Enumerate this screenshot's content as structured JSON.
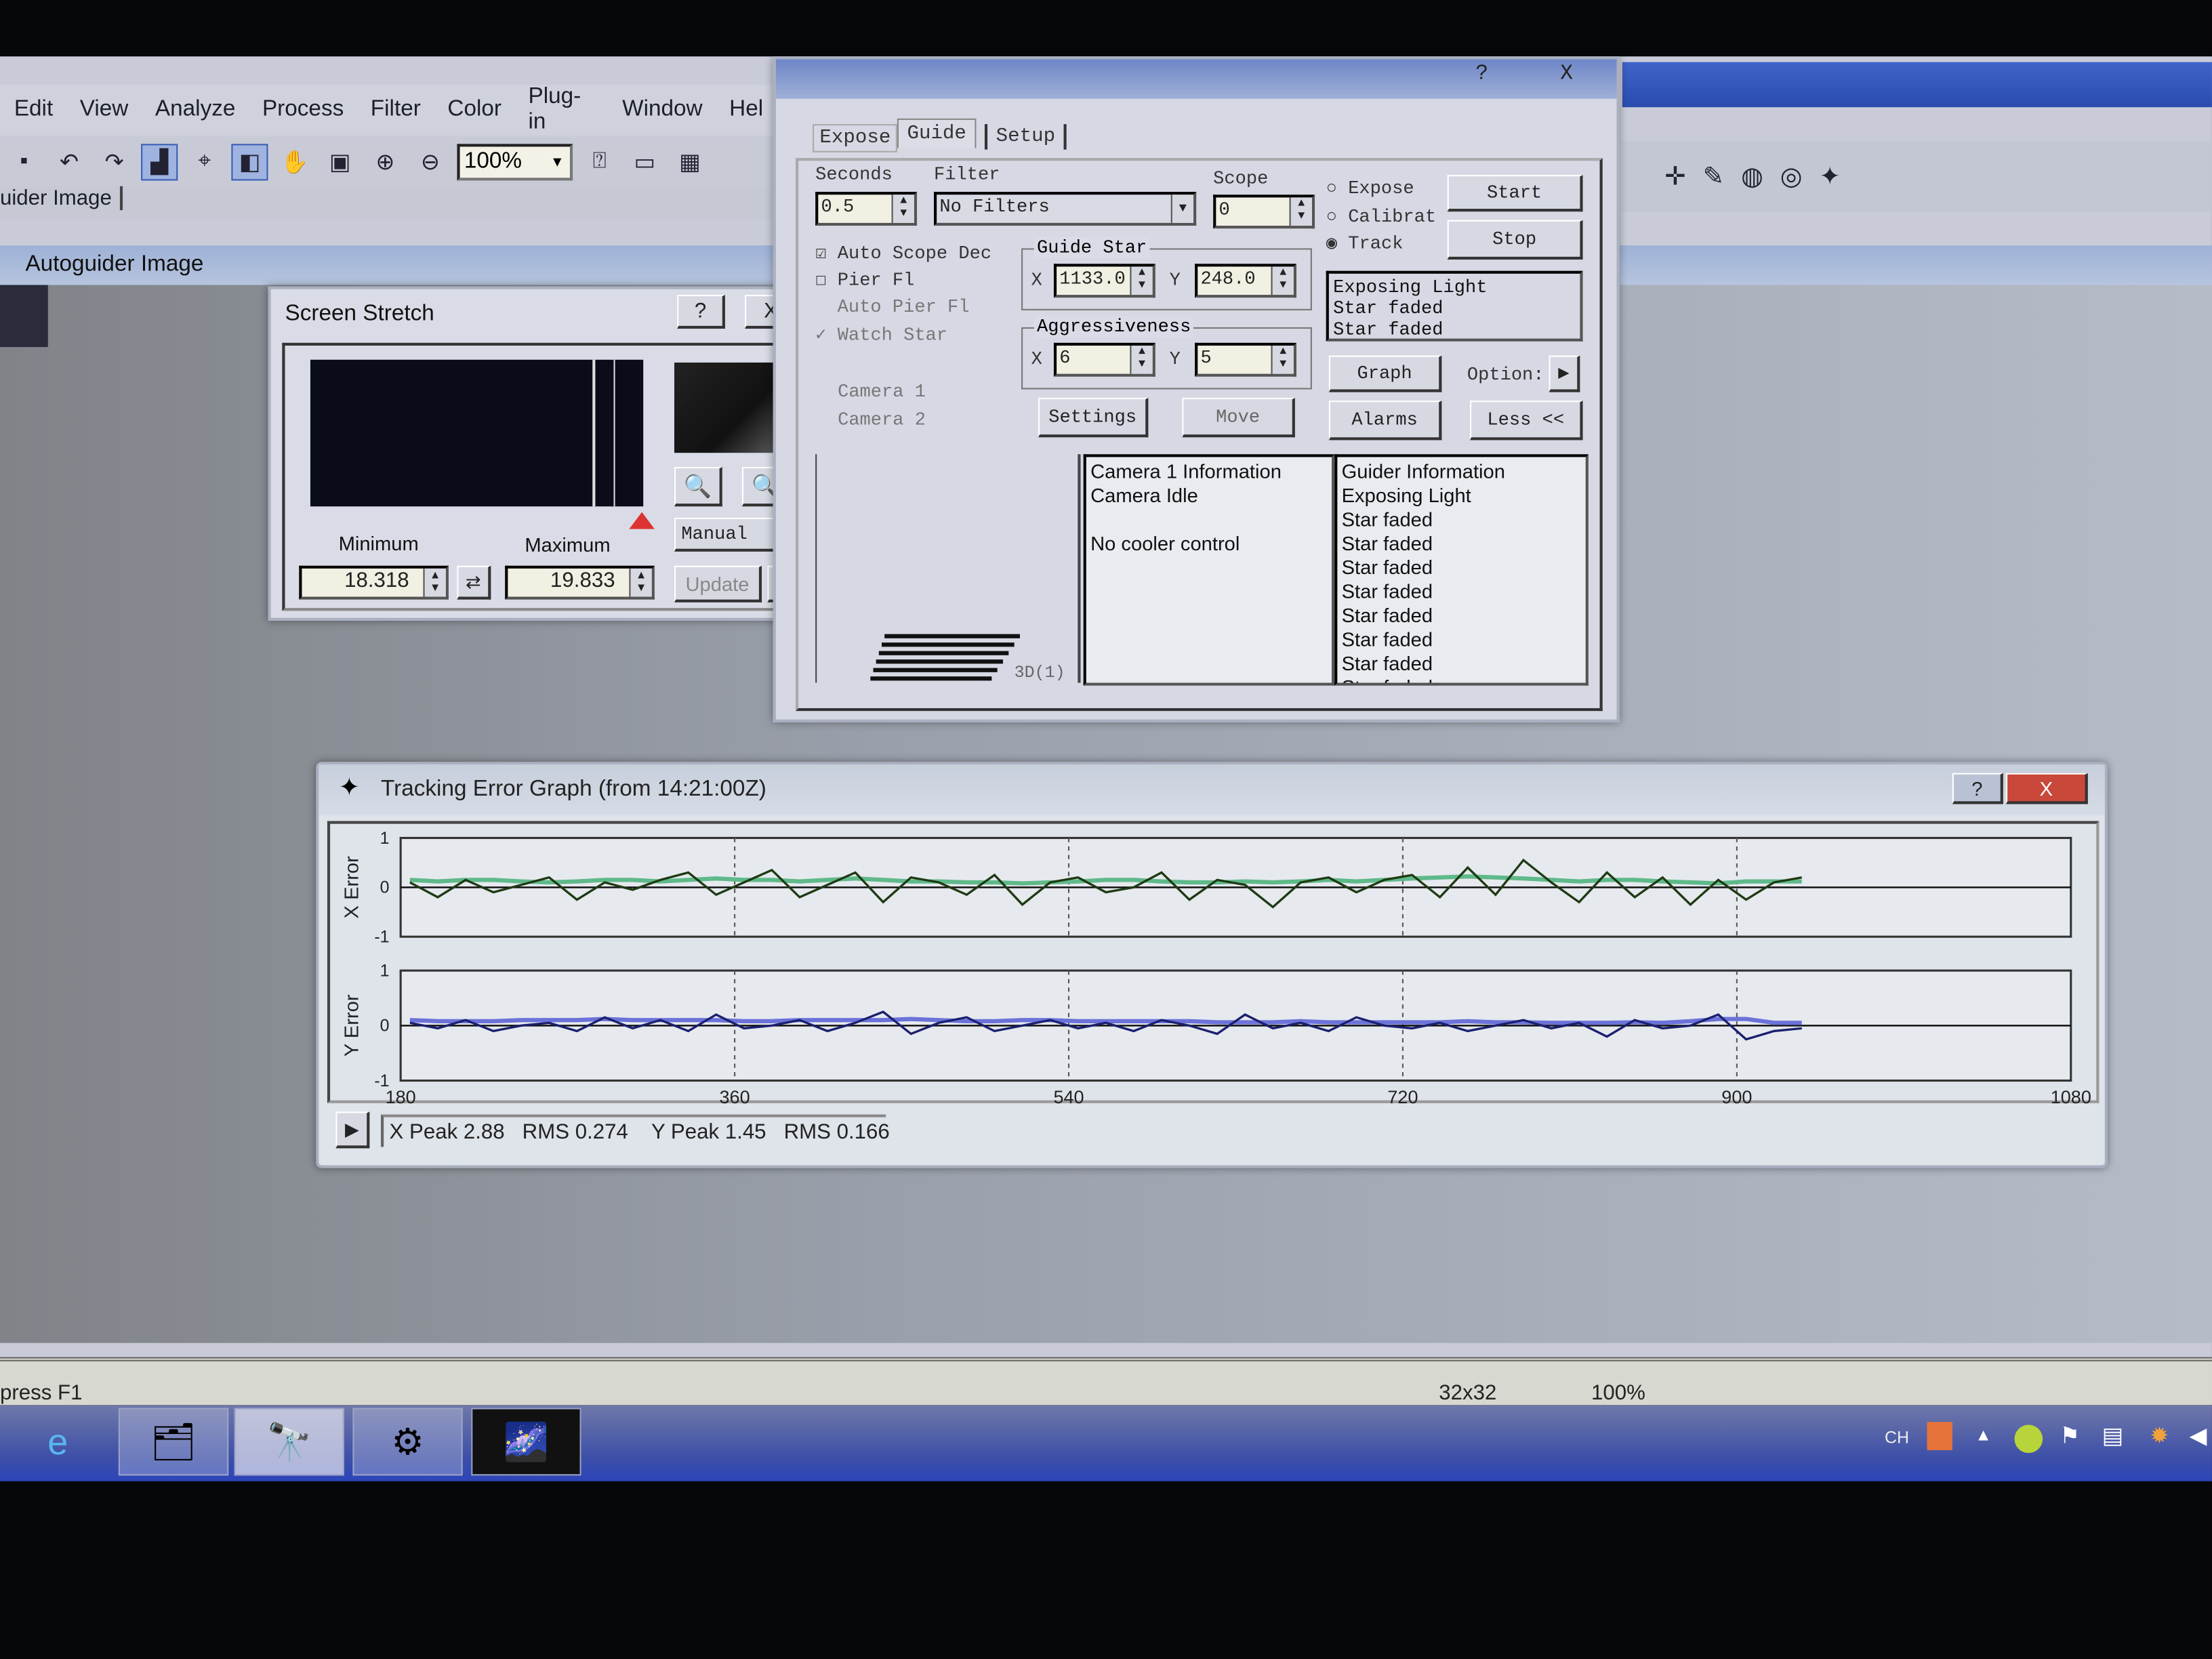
{
  "menu": [
    "Edit",
    "View",
    "Analyze",
    "Process",
    "Filter",
    "Color",
    "Plug-in",
    "Window",
    "Hel"
  ],
  "toolbar": {
    "zoom_value": "100%"
  },
  "doc_tab": "uider Image",
  "child_window_title": "Autoguider Image",
  "status_bar": {
    "hint": "press F1",
    "image_size": "32x32",
    "zoom": "100%"
  },
  "screen_stretch": {
    "title": "Screen Stretch",
    "help": "?",
    "close": "X",
    "minimum_label": "Minimum",
    "maximum_label": "Maximum",
    "minimum_value": "18.318",
    "maximum_value": "19.833",
    "mode": "Manual",
    "update_label": "Update",
    "more_label": ">>"
  },
  "guide_dialog": {
    "help": "?",
    "close": "X",
    "tabs": [
      "Expose",
      "Guide",
      "Setup"
    ],
    "active_tab": "Guide",
    "seconds_label": "Seconds",
    "seconds_value": "0.5",
    "filter_label": "Filter",
    "filter_value": "No Filters",
    "scope_label": "Scope",
    "scope_value": "0",
    "modes": [
      "Expose",
      "Calibrat",
      "Track"
    ],
    "selected_mode": "Track",
    "start_label": "Start",
    "stop_label": "Stop",
    "checkboxes": [
      {
        "label": "Auto Scope Dec",
        "checked": true
      },
      {
        "label": "Pier Fl",
        "checked": false
      },
      {
        "label": "Auto Pier Fl",
        "checked": false
      },
      {
        "label": "Watch Star",
        "checked": true
      }
    ],
    "camera_options": [
      "Camera 1",
      "Camera 2"
    ],
    "guide_star_label": "Guide Star",
    "guide_x": "1133.0",
    "guide_y": "248.0",
    "aggressiveness_label": "Aggressiveness",
    "aggr_x": "6",
    "aggr_y": "5",
    "x_label": "X",
    "y_label": "Y",
    "status_lines": [
      "Exposing Light",
      "Star faded",
      "Star faded"
    ],
    "graph_label": "Graph",
    "options_label": "Option:",
    "settings_label": "Settings",
    "move_label": "Move",
    "alarms_label": "Alarms",
    "less_label": "Less <<",
    "camera_info": [
      "Camera 1 Information",
      "Camera Idle",
      "",
      "No cooler control"
    ],
    "guider_info": [
      "Guider Information",
      "Exposing Light",
      "Star faded",
      "Star faded",
      "Star faded",
      "Star faded",
      "Star faded",
      "Star faded",
      "Star faded",
      "Star faded"
    ],
    "preview_text": "3D(1)"
  },
  "tracking_graph": {
    "title": "Tracking Error Graph (from 14:21:00Z)",
    "help": "?",
    "close": "X",
    "stats": "X Peak 2.88   RMS 0.274    Y Peak 1.45   RMS 0.166"
  },
  "chart_data": [
    {
      "type": "line",
      "ylabel": "X Error",
      "xlim": [
        180,
        1080
      ],
      "ylim": [
        -1,
        1
      ],
      "yticks": [
        "1",
        "0",
        "-1"
      ],
      "xticks": [
        "180",
        "360",
        "540",
        "720",
        "900",
        "1080"
      ],
      "grid": true,
      "x": [
        185,
        200,
        215,
        230,
        245,
        260,
        275,
        290,
        305,
        320,
        335,
        350,
        365,
        380,
        395,
        410,
        425,
        440,
        455,
        470,
        485,
        500,
        515,
        530,
        545,
        560,
        575,
        590,
        605,
        620,
        635,
        650,
        665,
        680,
        695,
        710,
        725,
        740,
        755,
        770,
        785,
        800,
        815,
        830,
        845,
        860,
        875,
        890,
        905,
        920,
        935
      ],
      "series": [
        {
          "color": "#1e3a12",
          "values": [
            0.1,
            -0.2,
            0.15,
            -0.1,
            0.05,
            0.2,
            -0.25,
            0.1,
            -0.05,
            0.15,
            0.3,
            -0.15,
            0.1,
            0.35,
            -0.2,
            0.05,
            0.3,
            -0.3,
            0.2,
            0.1,
            -0.15,
            0.25,
            -0.35,
            0.1,
            0.2,
            -0.1,
            0.0,
            0.3,
            -0.25,
            0.15,
            0.05,
            -0.4,
            0.1,
            0.2,
            -0.1,
            0.15,
            0.25,
            -0.2,
            0.4,
            -0.15,
            0.55,
            0.1,
            -0.3,
            0.3,
            -0.2,
            0.2,
            -0.35,
            0.15,
            -0.25,
            0.1,
            0.2
          ]
        },
        {
          "color": "#5fb98a",
          "values": [
            0.15,
            0.12,
            0.15,
            0.15,
            0.12,
            0.1,
            0.12,
            0.15,
            0.15,
            0.12,
            0.15,
            0.18,
            0.15,
            0.15,
            0.12,
            0.15,
            0.18,
            0.15,
            0.12,
            0.12,
            0.1,
            0.1,
            0.08,
            0.1,
            0.12,
            0.15,
            0.15,
            0.12,
            0.1,
            0.1,
            0.12,
            0.1,
            0.12,
            0.15,
            0.12,
            0.15,
            0.18,
            0.2,
            0.22,
            0.2,
            0.18,
            0.15,
            0.12,
            0.15,
            0.15,
            0.12,
            0.1,
            0.08,
            0.12,
            0.12,
            0.12
          ]
        }
      ]
    },
    {
      "type": "line",
      "ylabel": "Y Error",
      "xlim": [
        180,
        1080
      ],
      "ylim": [
        -1,
        1
      ],
      "yticks": [
        "1",
        "0",
        "-1"
      ],
      "xticks": [
        "180",
        "360",
        "540",
        "720",
        "900",
        "1080"
      ],
      "grid": true,
      "x": [
        185,
        200,
        215,
        230,
        245,
        260,
        275,
        290,
        305,
        320,
        335,
        350,
        365,
        380,
        395,
        410,
        425,
        440,
        455,
        470,
        485,
        500,
        515,
        530,
        545,
        560,
        575,
        590,
        605,
        620,
        635,
        650,
        665,
        680,
        695,
        710,
        725,
        740,
        755,
        770,
        785,
        800,
        815,
        830,
        845,
        860,
        875,
        890,
        905,
        920,
        935
      ],
      "series": [
        {
          "color": "#1a1f6e",
          "values": [
            0.05,
            -0.05,
            0.1,
            -0.1,
            0.0,
            0.05,
            -0.1,
            0.15,
            -0.05,
            0.1,
            -0.1,
            0.2,
            -0.05,
            0.0,
            0.1,
            -0.1,
            0.05,
            0.25,
            -0.15,
            0.05,
            0.15,
            -0.1,
            0.0,
            0.1,
            -0.05,
            0.05,
            -0.1,
            0.1,
            0.0,
            -0.15,
            0.2,
            -0.05,
            0.05,
            -0.1,
            0.15,
            0.0,
            -0.05,
            0.05,
            -0.1,
            0.0,
            0.1,
            -0.05,
            0.05,
            -0.2,
            0.1,
            -0.05,
            0.0,
            0.2,
            -0.25,
            -0.1,
            -0.05
          ]
        },
        {
          "color": "#6b72d8",
          "values": [
            0.1,
            0.08,
            0.08,
            0.08,
            0.1,
            0.1,
            0.1,
            0.12,
            0.1,
            0.1,
            0.1,
            0.1,
            0.08,
            0.08,
            0.1,
            0.1,
            0.1,
            0.1,
            0.12,
            0.1,
            0.08,
            0.08,
            0.1,
            0.1,
            0.08,
            0.08,
            0.08,
            0.08,
            0.08,
            0.06,
            0.06,
            0.06,
            0.08,
            0.06,
            0.06,
            0.06,
            0.06,
            0.06,
            0.08,
            0.06,
            0.06,
            0.05,
            0.05,
            0.05,
            0.06,
            0.05,
            0.08,
            0.12,
            0.12,
            0.05,
            0.05
          ]
        }
      ]
    }
  ]
}
